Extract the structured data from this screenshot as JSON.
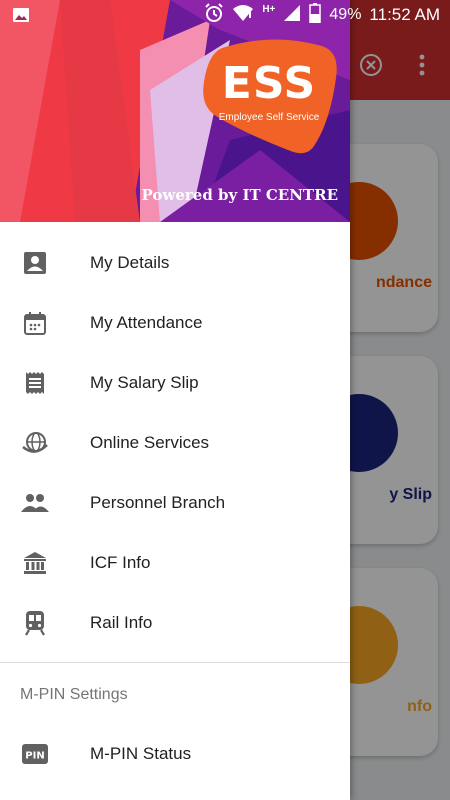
{
  "status_bar": {
    "battery": "49%",
    "time": "11:52 AM",
    "network": "H+",
    "icons": [
      "image-icon",
      "alarm-icon",
      "wifi-icon",
      "signal-icon",
      "battery-icon"
    ]
  },
  "background_app": {
    "cards": [
      {
        "label": "ndance",
        "color": "#e65100"
      },
      {
        "label": "y Slip",
        "color": "#1a237e"
      },
      {
        "label": "nfo",
        "color": "#f9a825"
      }
    ],
    "toolbar_icons": [
      "close-circle-icon",
      "more-vert-icon"
    ]
  },
  "drawer": {
    "header": {
      "logo_text": "ESS",
      "logo_subtitle": "Employee Self Service",
      "powered_by": "Powered by IT CENTRE",
      "logo_color": "#f06225"
    },
    "menu_items": [
      {
        "label": "My Details",
        "icon": "person-card-icon"
      },
      {
        "label": "My Attendance",
        "icon": "calendar-icon"
      },
      {
        "label": "My Salary Slip",
        "icon": "receipt-icon"
      },
      {
        "label": "Online Services",
        "icon": "globe-icon"
      },
      {
        "label": "Personnel Branch",
        "icon": "people-icon"
      },
      {
        "label": "ICF Info",
        "icon": "bank-icon"
      },
      {
        "label": "Rail Info",
        "icon": "train-icon"
      }
    ],
    "section_title": "M-PIN Settings",
    "pin_items": [
      {
        "label": "M-PIN Status",
        "icon": "pin-icon",
        "icon_text": "PIN"
      }
    ]
  }
}
